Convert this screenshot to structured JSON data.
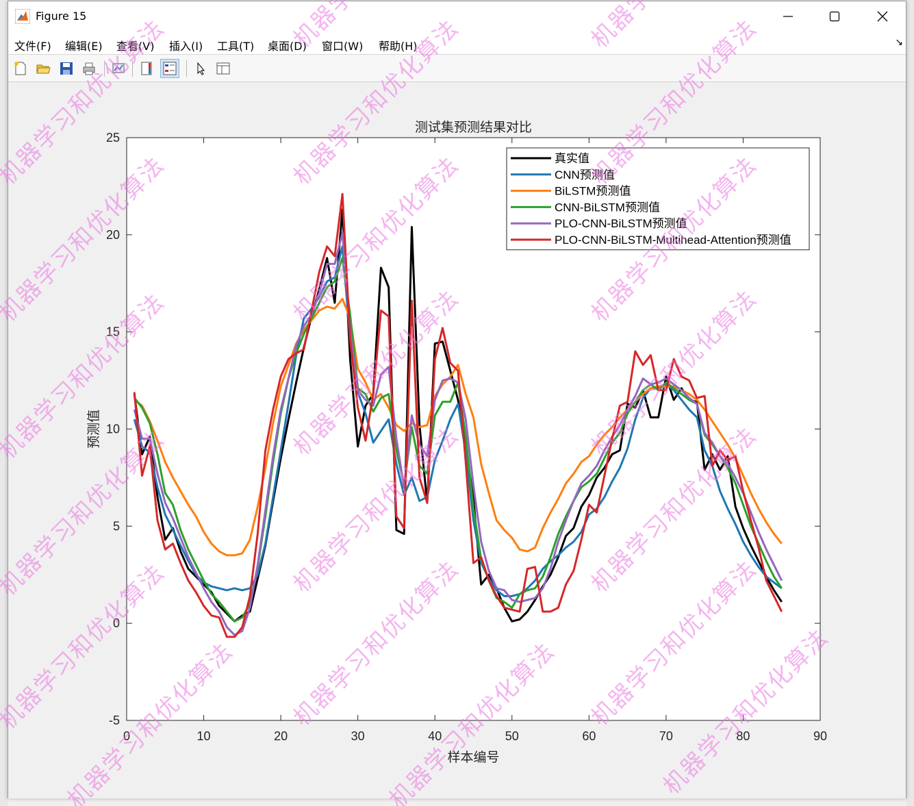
{
  "window": {
    "title": "Figure 15",
    "controls": {
      "minimize": "minimize-icon",
      "maximize": "maximize-icon",
      "close": "close-icon"
    }
  },
  "menu": [
    "文件(F)",
    "编辑(E)",
    "查看(V)",
    "插入(I)",
    "工具(T)",
    "桌面(D)",
    "窗口(W)",
    "帮助(H)"
  ],
  "toolbar": [
    "new-figure-icon",
    "open-file-icon",
    "save-icon",
    "print-icon",
    "link-plot-icon",
    "insert-colorbar-icon",
    "insert-legend-icon",
    "edit-plot-pointer-icon",
    "property-inspector-icon"
  ],
  "watermark": "机器学习和优化算法",
  "colors": {
    "真实值": "#000000",
    "CNN": "#1f77b4",
    "BiLSTM": "#ff7f0e",
    "CNN-BiLSTM": "#2ca02c",
    "PLO-CNN-BiLSTM": "#9467bd",
    "PLO-CNN-BiLSTM-Multihead-Attention": "#d62728"
  },
  "chart_data": {
    "type": "line",
    "title": "测试集预测结果对比",
    "xlabel": "样本编号",
    "ylabel": "预测值",
    "xlim": [
      0,
      90
    ],
    "ylim": [
      -5,
      25
    ],
    "xticks": [
      0,
      10,
      20,
      30,
      40,
      50,
      60,
      70,
      80,
      90
    ],
    "yticks": [
      -5,
      0,
      5,
      10,
      15,
      20,
      25
    ],
    "legend_position": "top-right",
    "grid": false,
    "x": [
      1,
      2,
      3,
      4,
      5,
      6,
      7,
      8,
      9,
      10,
      11,
      12,
      13,
      14,
      15,
      16,
      17,
      18,
      19,
      20,
      21,
      22,
      23,
      24,
      25,
      26,
      27,
      28,
      29,
      30,
      31,
      32,
      33,
      34,
      35,
      36,
      37,
      38,
      39,
      40,
      41,
      42,
      43,
      44,
      45,
      46,
      47,
      48,
      49,
      50,
      51,
      52,
      53,
      54,
      55,
      56,
      57,
      58,
      59,
      60,
      61,
      62,
      63,
      64,
      65,
      66,
      67,
      68,
      69,
      70,
      71,
      72,
      73,
      74,
      75,
      76,
      77,
      78,
      79,
      80,
      81,
      82,
      83,
      84,
      85
    ],
    "series": [
      {
        "name": "真实值",
        "color": "#000000",
        "values": [
          11.8,
          8.7,
          9.6,
          6.5,
          4.3,
          4.9,
          3.7,
          2.8,
          2.4,
          2.0,
          1.6,
          0.9,
          0.5,
          0.1,
          0.4,
          0.6,
          2.3,
          4.0,
          6.3,
          8.5,
          10.5,
          12.4,
          14.2,
          15.8,
          17.2,
          18.8,
          16.5,
          21.3,
          13.6,
          9.1,
          11.2,
          11.8,
          18.3,
          17.3,
          4.8,
          4.6,
          20.4,
          10.2,
          6.2,
          14.4,
          14.5,
          13.0,
          11.5,
          9.1,
          6.4,
          2.0,
          2.5,
          1.8,
          0.8,
          0.1,
          0.2,
          0.6,
          1.2,
          1.9,
          2.5,
          3.4,
          4.5,
          4.9,
          6.0,
          6.6,
          7.5,
          8.0,
          8.7,
          8.9,
          11.3,
          11.1,
          12.0,
          10.6,
          10.6,
          12.7,
          11.5,
          12.1,
          11.5,
          11.4,
          7.9,
          8.7,
          7.9,
          8.6,
          6.0,
          4.9,
          4.0,
          3.2,
          2.4,
          1.7,
          1.1
        ]
      },
      {
        "name": "CNN预测值",
        "color": "#1f77b4",
        "values": [
          10.5,
          9.1,
          8.8,
          7.0,
          5.6,
          4.8,
          4.0,
          3.2,
          2.5,
          2.1,
          1.9,
          1.8,
          1.7,
          1.8,
          1.7,
          1.8,
          2.5,
          4.1,
          6.5,
          8.9,
          11.3,
          13.8,
          15.7,
          16.2,
          16.8,
          17.6,
          17.8,
          19.4,
          14.6,
          11.9,
          10.8,
          9.3,
          9.9,
          10.5,
          8.2,
          6.6,
          7.5,
          6.3,
          6.5,
          8.4,
          9.4,
          10.5,
          11.3,
          8.8,
          5.3,
          3.1,
          2.3,
          1.7,
          1.4,
          1.4,
          1.5,
          1.8,
          2.2,
          2.8,
          3.2,
          3.5,
          3.9,
          4.2,
          4.7,
          5.6,
          5.9,
          6.5,
          7.3,
          8.0,
          9.0,
          10.5,
          11.6,
          12.1,
          12.1,
          12.3,
          12.0,
          11.5,
          11.0,
          10.6,
          8.9,
          8.1,
          6.8,
          5.9,
          5.1,
          4.2,
          3.5,
          2.9,
          2.4,
          2.1,
          1.8
        ]
      },
      {
        "name": "BiLSTM预测值",
        "color": "#ff7f0e",
        "values": [
          11.5,
          11.2,
          10.4,
          9.4,
          8.3,
          7.5,
          6.8,
          6.1,
          5.5,
          4.7,
          4.1,
          3.7,
          3.5,
          3.5,
          3.6,
          4.3,
          6.0,
          8.0,
          10.3,
          12.2,
          13.3,
          14.4,
          15.1,
          15.6,
          16.1,
          16.3,
          16.2,
          16.7,
          15.7,
          13.1,
          12.4,
          11.5,
          11.8,
          11.1,
          10.2,
          9.9,
          10.3,
          10.1,
          10.2,
          11.7,
          12.3,
          12.7,
          13.3,
          11.8,
          10.6,
          8.2,
          6.7,
          5.3,
          4.8,
          4.4,
          3.8,
          3.7,
          3.9,
          4.9,
          5.7,
          6.4,
          7.2,
          7.7,
          8.3,
          8.6,
          9.2,
          9.7,
          10.1,
          10.6,
          11.0,
          11.4,
          11.8,
          12.1,
          12.2,
          12.2,
          12.2,
          12.0,
          11.8,
          11.5,
          11.0,
          10.4,
          9.8,
          9.2,
          8.5,
          7.6,
          6.7,
          5.9,
          5.2,
          4.6,
          4.1
        ]
      },
      {
        "name": "CNN-BiLSTM预测值",
        "color": "#2ca02c",
        "values": [
          11.6,
          11.1,
          10.3,
          8.7,
          6.7,
          6.1,
          4.8,
          3.8,
          3.0,
          2.2,
          1.5,
          1.1,
          0.6,
          0.1,
          0.3,
          1.0,
          2.9,
          5.5,
          8.3,
          10.8,
          12.6,
          13.9,
          14.9,
          15.7,
          16.5,
          17.3,
          17.6,
          18.8,
          15.9,
          12.1,
          11.8,
          10.9,
          11.6,
          11.8,
          8.9,
          7.1,
          10.1,
          8.1,
          7.7,
          10.7,
          11.4,
          11.4,
          12.4,
          9.6,
          5.9,
          3.3,
          2.2,
          1.3,
          1.1,
          0.8,
          1.5,
          1.7,
          1.8,
          2.4,
          3.4,
          4.6,
          5.5,
          6.3,
          7.0,
          7.3,
          7.7,
          8.5,
          9.3,
          9.8,
          10.8,
          11.4,
          12.0,
          12.3,
          12.0,
          12.4,
          12.1,
          11.8,
          11.5,
          11.3,
          9.7,
          9.2,
          8.6,
          8.0,
          7.2,
          6.1,
          5.0,
          4.1,
          3.2,
          2.4,
          1.8
        ]
      },
      {
        "name": "PLO-CNN-BiLSTM预测值",
        "color": "#9467bd",
        "values": [
          11.0,
          9.5,
          9.5,
          7.7,
          6.2,
          5.4,
          4.4,
          3.4,
          2.6,
          1.8,
          1.1,
          0.6,
          -0.2,
          -0.6,
          -0.4,
          0.8,
          3.0,
          5.8,
          8.6,
          11.0,
          12.6,
          14.3,
          15.3,
          15.9,
          17.0,
          18.5,
          18.5,
          20.1,
          15.1,
          12.0,
          11.5,
          11.2,
          12.8,
          13.2,
          9.5,
          7.0,
          10.7,
          9.2,
          8.6,
          11.5,
          12.5,
          12.6,
          12.4,
          10.5,
          7.1,
          4.2,
          2.7,
          1.8,
          1.7,
          1.2,
          1.1,
          1.2,
          1.3,
          1.8,
          2.8,
          4.2,
          5.3,
          6.3,
          7.2,
          7.6,
          8.1,
          8.9,
          9.6,
          10.2,
          11.0,
          11.7,
          12.6,
          12.3,
          12.4,
          12.6,
          12.3,
          12.0,
          11.6,
          11.3,
          9.8,
          9.3,
          8.6,
          8.2,
          7.5,
          6.7,
          5.7,
          4.7,
          3.8,
          3.0,
          2.2
        ]
      },
      {
        "name": "PLO-CNN-BiLSTM-Multihead-Attention预测值",
        "color": "#d62728",
        "values": [
          11.9,
          7.6,
          9.1,
          5.3,
          3.8,
          4.1,
          3.1,
          2.2,
          1.6,
          0.9,
          0.4,
          0.3,
          -0.7,
          -0.7,
          -0.2,
          1.4,
          4.6,
          8.9,
          11.0,
          12.7,
          13.6,
          13.9,
          14.1,
          16.1,
          18.1,
          19.4,
          18.9,
          22.1,
          14.6,
          11.1,
          9.4,
          11.8,
          16.1,
          15.8,
          5.5,
          4.9,
          16.6,
          7.5,
          6.2,
          13.6,
          15.2,
          13.4,
          13.0,
          8.3,
          3.1,
          3.4,
          2.2,
          1.4,
          0.8,
          0.7,
          0.6,
          2.8,
          2.9,
          0.6,
          0.6,
          0.8,
          2.0,
          2.7,
          4.3,
          6.1,
          5.7,
          7.6,
          9.5,
          11.2,
          11.4,
          14.0,
          13.3,
          13.8,
          12.0,
          12.0,
          13.6,
          12.7,
          12.5,
          11.6,
          11.7,
          8.1,
          8.9,
          8.4,
          8.6,
          6.8,
          5.3,
          3.9,
          2.2,
          1.4,
          0.6
        ]
      }
    ]
  }
}
